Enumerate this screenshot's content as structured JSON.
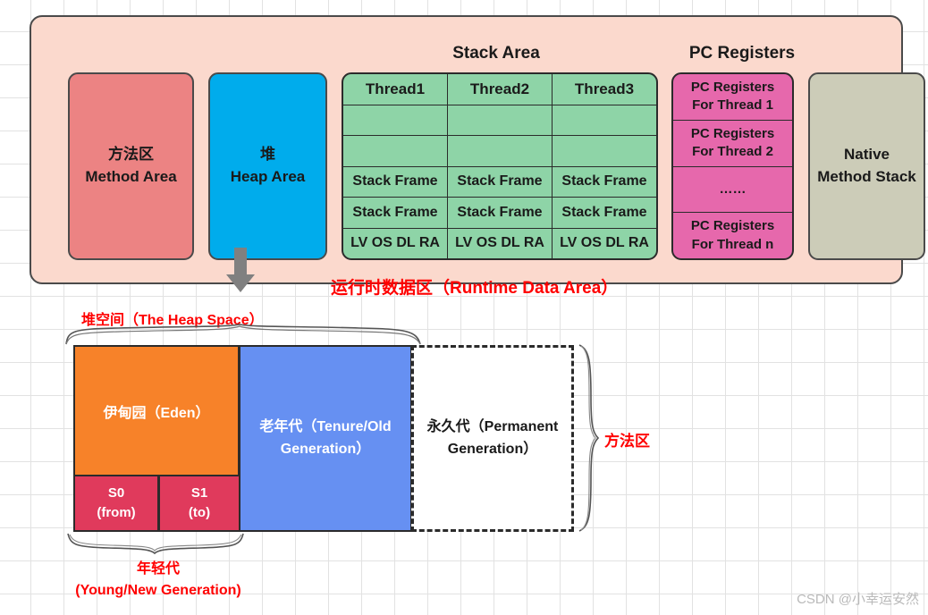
{
  "diagram": {
    "runtime_area": {
      "label": "运行时数据区（Runtime Data Area）",
      "method_area": {
        "cn": "方法区",
        "en": "Method Area"
      },
      "heap_area": {
        "cn": "堆",
        "en": "Heap Area"
      },
      "native_method_stack": {
        "line1": "Native",
        "line2": "Method Stack"
      },
      "stack_area": {
        "title": "Stack Area",
        "columns": [
          "Thread1",
          "Thread2",
          "Thread3"
        ],
        "rows": [
          [
            "Thread1",
            "Thread2",
            "Thread3"
          ],
          [
            "",
            "",
            ""
          ],
          [
            "",
            "",
            ""
          ],
          [
            "Stack Frame",
            "Stack Frame",
            "Stack Frame"
          ],
          [
            "Stack Frame",
            "Stack Frame",
            "Stack Frame"
          ],
          [
            "LV OS DL RA",
            "LV OS DL RA",
            "LV OS DL RA"
          ]
        ]
      },
      "pc_registers": {
        "title": "PC Registers",
        "rows": [
          "PC Registers\nFor Thread 1",
          "PC Registers\nFor Thread 2",
          "……",
          "PC Registers\nFor Thread n"
        ]
      }
    },
    "heap_space": {
      "label": "堆空间（The Heap Space）",
      "eden": "伊甸园（Eden）",
      "s0": {
        "line1": "S0",
        "line2": "(from)"
      },
      "s1": {
        "line1": "S1",
        "line2": "(to)"
      },
      "tenure": "老年代（Tenure/Old Generation）",
      "permanent": "永久代（Permanent Generation）",
      "method_area_brace_label": "方法区",
      "young_generation_label": "年轻代\n(Young/New Generation)",
      "young_generation_line1": "年轻代",
      "young_generation_line2": "(Young/New Generation)"
    },
    "watermark": "CSDN @小幸运安然",
    "colors": {
      "runtime_container_bg": "#fbd9cd",
      "method_area": "#ec8383",
      "heap_area": "#00acec",
      "stack_area": "#8ed4a7",
      "pc_registers": "#e668ac",
      "native_method_stack": "#ccccb8",
      "eden": "#f78229",
      "survivor": "#e03a5c",
      "tenure": "#6690f2",
      "permanent": "#ffffff",
      "accent_red": "#ff0000",
      "arrow_gray": "#808080"
    }
  }
}
